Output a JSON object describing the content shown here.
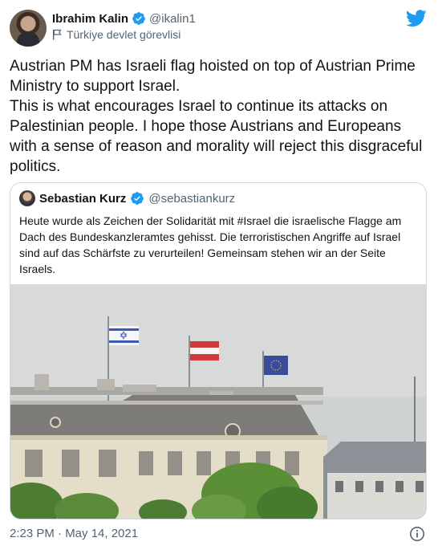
{
  "tweet": {
    "author": {
      "name": "Ibrahim Kalin",
      "handle": "@ikalin1",
      "label": "Türkiye devlet görevlisi"
    },
    "text": "Austrian PM has Israeli flag hoisted on top of Austrian Prime Ministry to support Israel.\nThis is what encourages Israel to continue its attacks on Palestinian people. I hope those Austrians and Europeans with a sense of reason and morality will reject this disgraceful politics.",
    "timestamp": "2:23 PM · May 14, 2021"
  },
  "quoted_tweet": {
    "author": {
      "name": "Sebastian Kurz",
      "handle": "@sebastiankurz"
    },
    "text": "Heute wurde als Zeichen der Solidarität mit #Israel die israelische Flagge am Dach des Bundeskanzleramtes gehisst. Die terroristischen Angriffe auf Israel sind auf das Schärfste zu verurteilen! Gemeinsam stehen wir an der Seite Israels."
  },
  "icons": {
    "brand": "twitter-bird-icon",
    "verified": "verified-badge-icon",
    "label": "government-flag-icon",
    "info": "info-icon"
  },
  "colors": {
    "accent": "#1d9bf0",
    "text": "#0f1419",
    "secondary": "#536471",
    "border": "#cfd9de"
  }
}
